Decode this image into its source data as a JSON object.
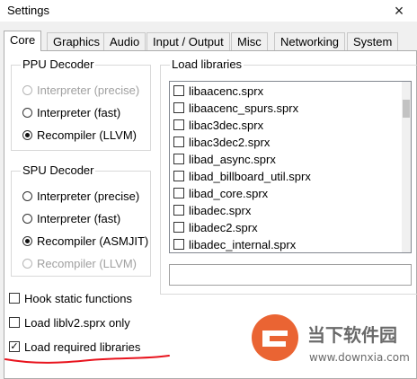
{
  "window": {
    "title": "Settings",
    "close_glyph": "×"
  },
  "tabs": [
    "Core",
    "Graphics",
    "Audio",
    "Input / Output",
    "Misc",
    "Networking",
    "System"
  ],
  "ppu": {
    "legend": "PPU Decoder",
    "options": [
      {
        "label": "Interpreter (precise)",
        "checked": false,
        "disabled": true
      },
      {
        "label": "Interpreter (fast)",
        "checked": false,
        "disabled": false
      },
      {
        "label": "Recompiler (LLVM)",
        "checked": true,
        "disabled": false
      }
    ]
  },
  "spu": {
    "legend": "SPU Decoder",
    "options": [
      {
        "label": "Interpreter (precise)",
        "checked": false,
        "disabled": false
      },
      {
        "label": "Interpreter (fast)",
        "checked": false,
        "disabled": false
      },
      {
        "label": "Recompiler (ASMJIT)",
        "checked": true,
        "disabled": false
      },
      {
        "label": "Recompiler (LLVM)",
        "checked": false,
        "disabled": true
      }
    ]
  },
  "libraries": {
    "legend": "Load libraries",
    "items": [
      "libaacenc.sprx",
      "libaacenc_spurs.sprx",
      "libac3dec.sprx",
      "libac3dec2.sprx",
      "libad_async.sprx",
      "libad_billboard_util.sprx",
      "libad_core.sprx",
      "libadec.sprx",
      "libadec2.sprx",
      "libadec_internal.sprx"
    ],
    "filter_value": ""
  },
  "checks": [
    {
      "label": "Hook static functions",
      "checked": false
    },
    {
      "label": "Load liblv2.sprx only",
      "checked": false
    },
    {
      "label": "Load required libraries",
      "checked": true
    }
  ],
  "watermark": {
    "brand": "当下软件园",
    "url": "www.downxia.com"
  },
  "colors": {
    "annotation_red": "#e8141e",
    "watermark_orange": "#e8541e"
  },
  "icons": {
    "close": "close-icon",
    "checkmark": "checkmark-icon"
  }
}
